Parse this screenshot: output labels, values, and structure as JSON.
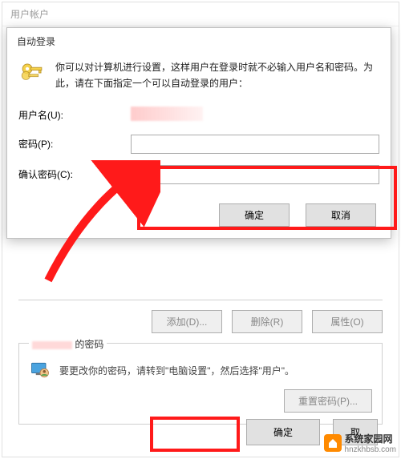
{
  "outerWindow": {
    "title": "用户帐户"
  },
  "innerDialog": {
    "title": "自动登录",
    "introText": "你可以对计算机进行设置，这样用户在登录时就不必输入用户名和密码。为此，请在下面指定一个可以自动登录的用户：",
    "username": {
      "label": "用户名(U):"
    },
    "password": {
      "label": "密码(P):",
      "value": ""
    },
    "confirm": {
      "label": "确认密码(C):",
      "value": ""
    },
    "ok": "确定",
    "cancel": "取消"
  },
  "back": {
    "addBtn": "添加(D)...",
    "removeBtn": "删除(R)",
    "propsBtn": "属性(O)",
    "pwdTitleSuffix": "的密码",
    "pwdHint": "要更改你的密码，请转到\"电脑设置\"，然后选择\"用户\"。",
    "resetBtn": "重置密码(P)..."
  },
  "footer": {
    "ok": "确定",
    "cancel": "取"
  },
  "watermark": {
    "brand": "系统家园网",
    "url": "hnzkhbsb.com"
  }
}
